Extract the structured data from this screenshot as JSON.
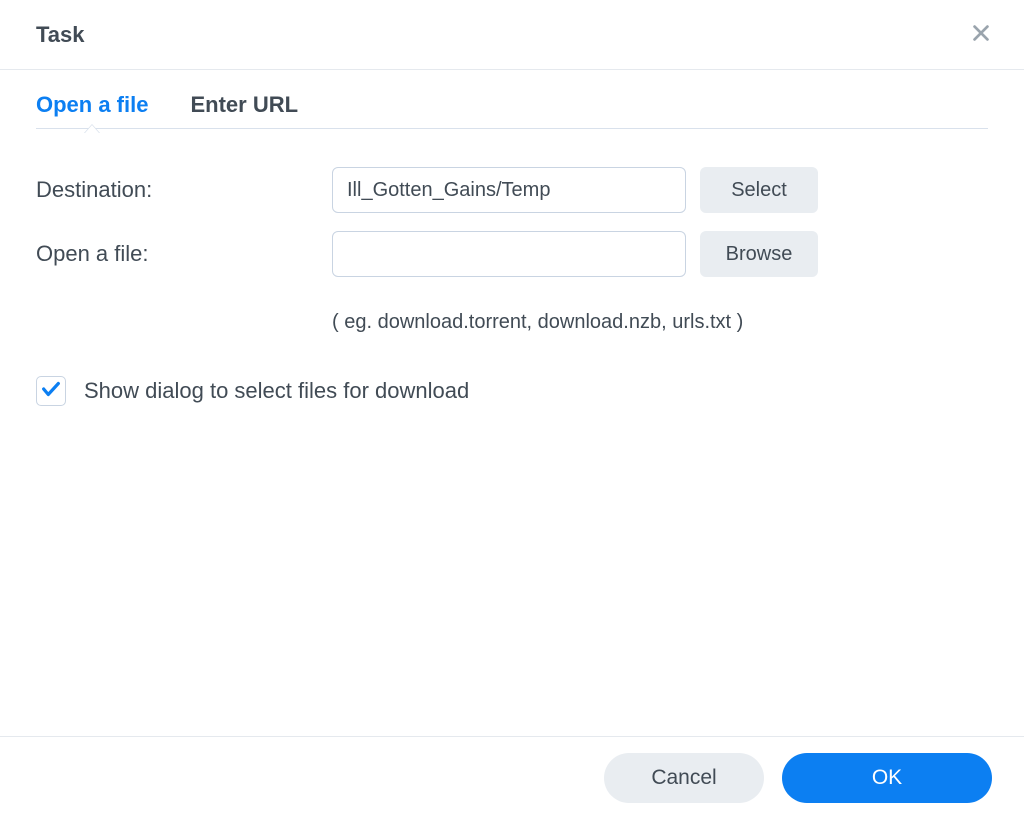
{
  "header": {
    "title": "Task"
  },
  "tabs": {
    "open_file": "Open a file",
    "enter_url": "Enter URL"
  },
  "form": {
    "destination_label": "Destination:",
    "destination_value": "Ill_Gotten_Gains/Temp",
    "select_button": "Select",
    "open_file_label": "Open a file:",
    "open_file_value": "",
    "browse_button": "Browse",
    "hint": "( eg. download.torrent, download.nzb, urls.txt )",
    "checkbox_label": "Show dialog to select files for download",
    "checkbox_checked": true
  },
  "footer": {
    "cancel": "Cancel",
    "ok": "OK"
  },
  "colors": {
    "accent": "#0C7FF2"
  }
}
